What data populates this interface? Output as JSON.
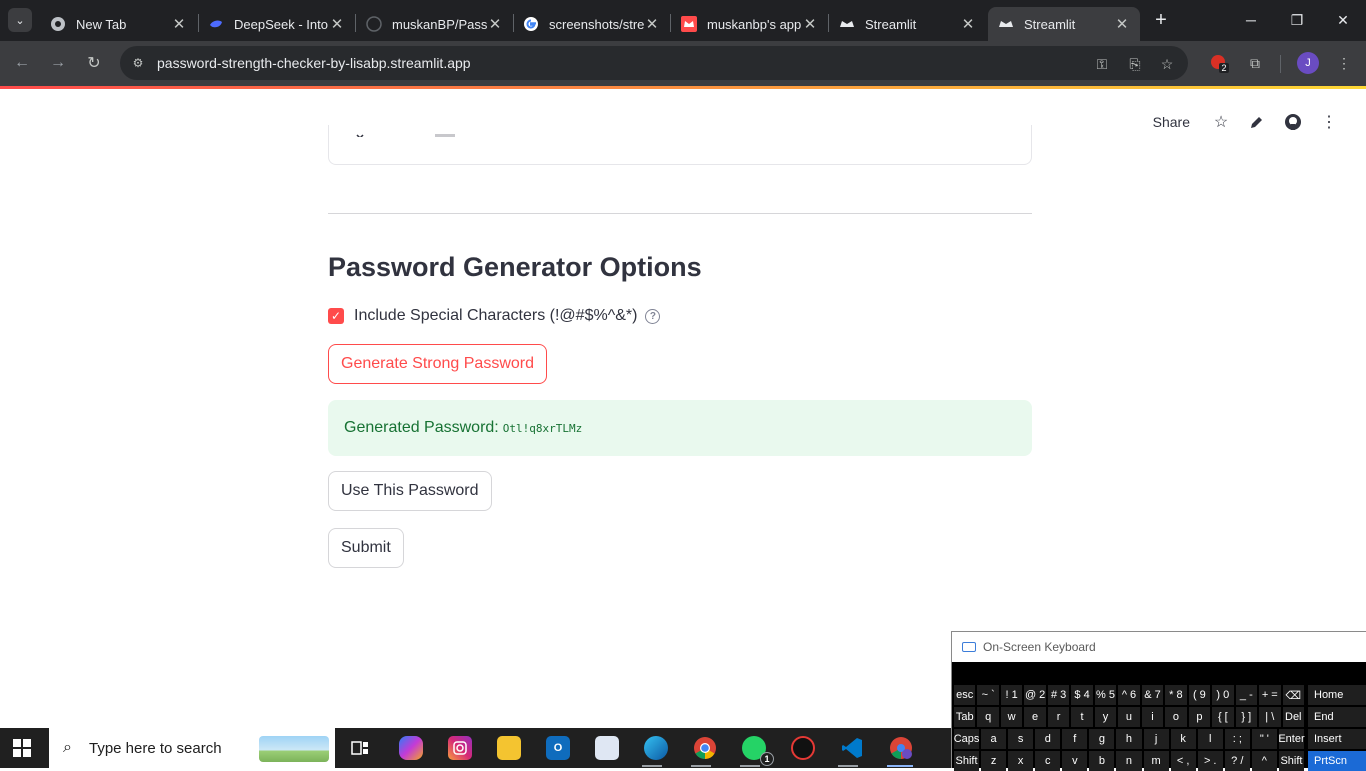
{
  "browser": {
    "tabs": [
      {
        "title": "New Tab",
        "icon": "chrome-icon"
      },
      {
        "title": "DeepSeek - Into",
        "icon": "deepseek-icon"
      },
      {
        "title": "muskanBP/Passw",
        "icon": "github-icon"
      },
      {
        "title": "screenshots/stre",
        "icon": "google-icon"
      },
      {
        "title": "muskanbp's app",
        "icon": "streamlit-crown-icon"
      },
      {
        "title": "Streamlit",
        "icon": "streamlit-crown-icon"
      },
      {
        "title": "Streamlit",
        "icon": "streamlit-crown-icon"
      }
    ],
    "active_tab_index": 6,
    "url": "password-strength-checker-by-lisabp.streamlit.app",
    "extension_badge": "2",
    "profile_initial": "J",
    "accent_color": "#6a4cc2"
  },
  "app": {
    "header": {
      "share_label": "Share",
      "icons": [
        "star-icon",
        "edit-pencil-icon",
        "github-icon",
        "more-vert-icon"
      ]
    },
    "section_title": "Password Generator Options",
    "special_chars_checkbox": {
      "label": "Include Special Characters (!@#$%^&*)",
      "checked": true,
      "help_icon": "help-circle-icon"
    },
    "generate_button_label": "Generate Strong Password",
    "generated": {
      "label": "Generated Password:",
      "password": "Otl!q8xrTLMz"
    },
    "use_password_button_label": "Use This Password",
    "submit_button_label": "Submit",
    "colors": {
      "primary": "#ff4b4b",
      "success_bg": "#e9f9ee",
      "success_text": "#177233",
      "text": "#31333f"
    }
  },
  "osk": {
    "title": "On-Screen Keyboard",
    "row1": [
      "esc",
      "~ `",
      "! 1",
      "@ 2",
      "# 3",
      "$ 4",
      "% 5",
      "^ 6",
      "& 7",
      "* 8",
      "( 9",
      ") 0",
      "_ -",
      "+ =",
      "⌫"
    ],
    "row2": [
      "Tab",
      "q",
      "w",
      "e",
      "r",
      "t",
      "y",
      "u",
      "i",
      "o",
      "p",
      "{ [",
      "} ]",
      "| \\",
      "Del"
    ],
    "row3": [
      "Caps",
      "a",
      "s",
      "d",
      "f",
      "g",
      "h",
      "j",
      "k",
      "l",
      ": ;",
      "\" '",
      "Enter"
    ],
    "row4": [
      "Shift",
      "z",
      "x",
      "c",
      "v",
      "b",
      "n",
      "m",
      "< ,",
      "> .",
      "? /",
      "^",
      "Shift"
    ],
    "side": [
      "Home",
      "End",
      "Insert",
      "PrtScn"
    ]
  },
  "taskbar": {
    "search_placeholder": "Type here to search",
    "apps": [
      "task-view-icon",
      "copilot-icon",
      "instagram-icon",
      "file-explorer-icon",
      "outlook-icon",
      "photos-icon",
      "edge-icon",
      "chrome-icon",
      "whatsapp-icon",
      "game-app-icon",
      "vscode-icon",
      "chrome-profile-icon"
    ],
    "whatsapp_badge": "1"
  }
}
